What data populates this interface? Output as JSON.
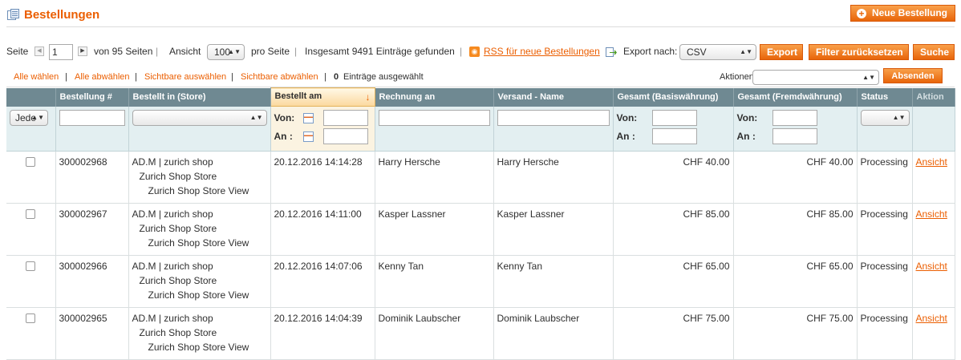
{
  "page": {
    "title": "Bestellungen",
    "new_order_label": "Neue Bestellung",
    "icon": "orders-icon"
  },
  "pager": {
    "page_label": "Seite",
    "current_page": "1",
    "of_pages": "von 95 Seiten",
    "view_label": "Ansicht",
    "per_page": "100",
    "per_page_suffix": "pro Seite",
    "total": "Insgesamt 9491 Einträge gefunden",
    "rss_label": "RSS für neue Bestellungen",
    "export_label": "Export nach:",
    "export_format": "CSV",
    "export_btn": "Export",
    "reset_btn": "Filter zurücksetzen",
    "search_btn": "Suche"
  },
  "massaction": {
    "select_all": "Alle wählen",
    "unselect_all": "Alle abwählen",
    "select_visible": "Sichtbare auswählen",
    "unselect_visible": "Sichtbare abwählen",
    "selected_count": "0",
    "selected_suffix": "Einträge ausgewählt",
    "actions_label": "Aktionen",
    "submit_btn": "Absenden"
  },
  "grid": {
    "columns": {
      "order": "Bestellung #",
      "store": "Bestellt in (Store)",
      "date": "Bestellt am",
      "bill": "Rechnung an",
      "ship": "Versand - Name",
      "base": "Gesamt (Basiswährung)",
      "purchased": "Gesamt (Fremdwährung)",
      "status": "Status",
      "action": "Aktion"
    },
    "filter": {
      "massaction_any": "Jede",
      "from": "Von:",
      "to": "An :"
    },
    "rows": [
      {
        "order": "300002968",
        "store1": "AD.M | zurich shop",
        "store2": "Zurich Shop Store",
        "store3": "Zurich Shop Store View",
        "date": "20.12.2016 14:14:28",
        "bill": "Harry Hersche",
        "ship": "Harry Hersche",
        "base": "CHF 40.00",
        "purchased": "CHF 40.00",
        "status": "Processing",
        "action": "Ansicht"
      },
      {
        "order": "300002967",
        "store1": "AD.M | zurich shop",
        "store2": "Zurich Shop Store",
        "store3": "Zurich Shop Store View",
        "date": "20.12.2016 14:11:00",
        "bill": "Kasper Lassner",
        "ship": "Kasper Lassner",
        "base": "CHF 85.00",
        "purchased": "CHF 85.00",
        "status": "Processing",
        "action": "Ansicht"
      },
      {
        "order": "300002966",
        "store1": "AD.M | zurich shop",
        "store2": "Zurich Shop Store",
        "store3": "Zurich Shop Store View",
        "date": "20.12.2016 14:07:06",
        "bill": "Kenny Tan",
        "ship": "Kenny Tan",
        "base": "CHF 65.00",
        "purchased": "CHF 65.00",
        "status": "Processing",
        "action": "Ansicht"
      },
      {
        "order": "300002965",
        "store1": "AD.M | zurich shop",
        "store2": "Zurich Shop Store",
        "store3": "Zurich Shop Store View",
        "date": "20.12.2016 14:04:39",
        "bill": "Dominik Laubscher",
        "ship": "Dominik Laubscher",
        "base": "CHF 75.00",
        "purchased": "CHF 75.00",
        "status": "Processing",
        "action": "Ansicht"
      }
    ]
  }
}
